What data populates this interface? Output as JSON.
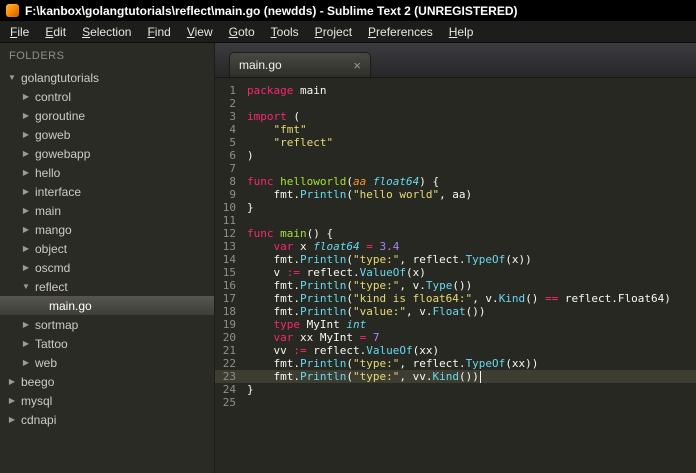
{
  "window": {
    "title": "F:\\kanbox\\golangtutorials\\reflect\\main.go (newdds) - Sublime Text 2 (UNREGISTERED)"
  },
  "menu": {
    "items": [
      "File",
      "Edit",
      "Selection",
      "Find",
      "View",
      "Goto",
      "Tools",
      "Project",
      "Preferences",
      "Help"
    ]
  },
  "sidebar": {
    "header": "FOLDERS",
    "items": [
      {
        "label": "golangtutorials",
        "level": 0,
        "type": "folder",
        "expanded": true,
        "selected": false
      },
      {
        "label": "control",
        "level": 1,
        "type": "folder",
        "expanded": false,
        "selected": false
      },
      {
        "label": "goroutine",
        "level": 1,
        "type": "folder",
        "expanded": false,
        "selected": false
      },
      {
        "label": "goweb",
        "level": 1,
        "type": "folder",
        "expanded": false,
        "selected": false
      },
      {
        "label": "gowebapp",
        "level": 1,
        "type": "folder",
        "expanded": false,
        "selected": false
      },
      {
        "label": "hello",
        "level": 1,
        "type": "folder",
        "expanded": false,
        "selected": false
      },
      {
        "label": "interface",
        "level": 1,
        "type": "folder",
        "expanded": false,
        "selected": false
      },
      {
        "label": "main",
        "level": 1,
        "type": "folder",
        "expanded": false,
        "selected": false
      },
      {
        "label": "mango",
        "level": 1,
        "type": "folder",
        "expanded": false,
        "selected": false
      },
      {
        "label": "object",
        "level": 1,
        "type": "folder",
        "expanded": false,
        "selected": false
      },
      {
        "label": "oscmd",
        "level": 1,
        "type": "folder",
        "expanded": false,
        "selected": false
      },
      {
        "label": "reflect",
        "level": 1,
        "type": "folder",
        "expanded": true,
        "selected": false
      },
      {
        "label": "main.go",
        "level": 2,
        "type": "file",
        "expanded": false,
        "selected": true
      },
      {
        "label": "sortmap",
        "level": 1,
        "type": "folder",
        "expanded": false,
        "selected": false
      },
      {
        "label": "Tattoo",
        "level": 1,
        "type": "folder",
        "expanded": false,
        "selected": false
      },
      {
        "label": "web",
        "level": 1,
        "type": "folder",
        "expanded": false,
        "selected": false
      },
      {
        "label": "beego",
        "level": 0,
        "type": "folder",
        "expanded": false,
        "selected": false
      },
      {
        "label": "mysql",
        "level": 0,
        "type": "folder",
        "expanded": false,
        "selected": false
      },
      {
        "label": "cdnapi",
        "level": 0,
        "type": "folder",
        "expanded": false,
        "selected": false
      }
    ]
  },
  "editor": {
    "tab": {
      "label": "main.go",
      "close": "×"
    },
    "active_line": 23,
    "lines": [
      {
        "no": 1,
        "tokens": [
          [
            "kw",
            "package"
          ],
          [
            "pl",
            " main"
          ]
        ]
      },
      {
        "no": 2,
        "tokens": []
      },
      {
        "no": 3,
        "tokens": [
          [
            "kw",
            "import"
          ],
          [
            "pl",
            " ("
          ]
        ]
      },
      {
        "no": 4,
        "tokens": [
          [
            "pl",
            "    "
          ],
          [
            "str",
            "\"fmt\""
          ]
        ]
      },
      {
        "no": 5,
        "tokens": [
          [
            "pl",
            "    "
          ],
          [
            "str",
            "\"reflect\""
          ]
        ]
      },
      {
        "no": 6,
        "tokens": [
          [
            "pl",
            ")"
          ]
        ]
      },
      {
        "no": 7,
        "tokens": []
      },
      {
        "no": 8,
        "tokens": [
          [
            "kw",
            "func"
          ],
          [
            "fn",
            " helloworld"
          ],
          [
            "pl",
            "("
          ],
          [
            "param",
            "aa"
          ],
          [
            "pl",
            " "
          ],
          [
            "ty",
            "float64"
          ],
          [
            "pl",
            ") {"
          ]
        ]
      },
      {
        "no": 9,
        "tokens": [
          [
            "pl",
            "    fmt."
          ],
          [
            "call",
            "Println"
          ],
          [
            "pl",
            "("
          ],
          [
            "str",
            "\"hello world\""
          ],
          [
            "pl",
            ", aa)"
          ]
        ]
      },
      {
        "no": 10,
        "tokens": [
          [
            "pl",
            "}"
          ]
        ]
      },
      {
        "no": 11,
        "tokens": []
      },
      {
        "no": 12,
        "tokens": [
          [
            "kw",
            "func"
          ],
          [
            "fn",
            " main"
          ],
          [
            "pl",
            "() {"
          ]
        ]
      },
      {
        "no": 13,
        "tokens": [
          [
            "pl",
            "    "
          ],
          [
            "kw",
            "var"
          ],
          [
            "pl",
            " x "
          ],
          [
            "ty",
            "float64"
          ],
          [
            "pl",
            " "
          ],
          [
            "op",
            "="
          ],
          [
            "pl",
            " "
          ],
          [
            "num",
            "3.4"
          ]
        ]
      },
      {
        "no": 14,
        "tokens": [
          [
            "pl",
            "    fmt."
          ],
          [
            "call",
            "Println"
          ],
          [
            "pl",
            "("
          ],
          [
            "str",
            "\"type:\""
          ],
          [
            "pl",
            ", reflect."
          ],
          [
            "call",
            "TypeOf"
          ],
          [
            "pl",
            "(x))"
          ]
        ]
      },
      {
        "no": 15,
        "tokens": [
          [
            "pl",
            "    v "
          ],
          [
            "op",
            ":="
          ],
          [
            "pl",
            " reflect."
          ],
          [
            "call",
            "ValueOf"
          ],
          [
            "pl",
            "(x)"
          ]
        ]
      },
      {
        "no": 16,
        "tokens": [
          [
            "pl",
            "    fmt."
          ],
          [
            "call",
            "Println"
          ],
          [
            "pl",
            "("
          ],
          [
            "str",
            "\"type:\""
          ],
          [
            "pl",
            ", v."
          ],
          [
            "call",
            "Type"
          ],
          [
            "pl",
            "())"
          ]
        ]
      },
      {
        "no": 17,
        "tokens": [
          [
            "pl",
            "    fmt."
          ],
          [
            "call",
            "Println"
          ],
          [
            "pl",
            "("
          ],
          [
            "str",
            "\"kind is float64:\""
          ],
          [
            "pl",
            ", v."
          ],
          [
            "call",
            "Kind"
          ],
          [
            "pl",
            "() "
          ],
          [
            "op",
            "=="
          ],
          [
            "pl",
            " reflect.Float64)"
          ]
        ]
      },
      {
        "no": 18,
        "tokens": [
          [
            "pl",
            "    fmt."
          ],
          [
            "call",
            "Println"
          ],
          [
            "pl",
            "("
          ],
          [
            "str",
            "\"value:\""
          ],
          [
            "pl",
            ", v."
          ],
          [
            "call",
            "Float"
          ],
          [
            "pl",
            "())"
          ]
        ]
      },
      {
        "no": 19,
        "tokens": [
          [
            "pl",
            "    "
          ],
          [
            "kw",
            "type"
          ],
          [
            "pl",
            " MyInt "
          ],
          [
            "ty",
            "int"
          ]
        ]
      },
      {
        "no": 20,
        "tokens": [
          [
            "pl",
            "    "
          ],
          [
            "kw",
            "var"
          ],
          [
            "pl",
            " xx MyInt "
          ],
          [
            "op",
            "="
          ],
          [
            "pl",
            " "
          ],
          [
            "num",
            "7"
          ]
        ]
      },
      {
        "no": 21,
        "tokens": [
          [
            "pl",
            "    vv "
          ],
          [
            "op",
            ":="
          ],
          [
            "pl",
            " reflect."
          ],
          [
            "call",
            "ValueOf"
          ],
          [
            "pl",
            "(xx)"
          ]
        ]
      },
      {
        "no": 22,
        "tokens": [
          [
            "pl",
            "    fmt."
          ],
          [
            "call",
            "Println"
          ],
          [
            "pl",
            "("
          ],
          [
            "str",
            "\"type:\""
          ],
          [
            "pl",
            ", reflect."
          ],
          [
            "call",
            "TypeOf"
          ],
          [
            "pl",
            "(xx))"
          ]
        ]
      },
      {
        "no": 23,
        "tokens": [
          [
            "pl",
            "    fmt."
          ],
          [
            "call",
            "Println"
          ],
          [
            "pl",
            "("
          ],
          [
            "str",
            "\"type:\""
          ],
          [
            "pl",
            ", vv."
          ],
          [
            "call",
            "Kind"
          ],
          [
            "pl",
            "())"
          ]
        ]
      },
      {
        "no": 24,
        "tokens": [
          [
            "pl",
            "}"
          ]
        ]
      },
      {
        "no": 25,
        "tokens": []
      }
    ]
  },
  "colors": {
    "editor_background": "#272822",
    "sidebar_background": "#2b2b26",
    "keyword": "#f92672",
    "string": "#e6db74",
    "number": "#ae81ff",
    "type": "#66d9ef",
    "function_def": "#a6e22e",
    "parameter": "#fd971f",
    "text": "#f8f8f2",
    "line_number": "#8f908a",
    "active_line": "#3e3d32",
    "selection_highlight": "#55554f"
  }
}
